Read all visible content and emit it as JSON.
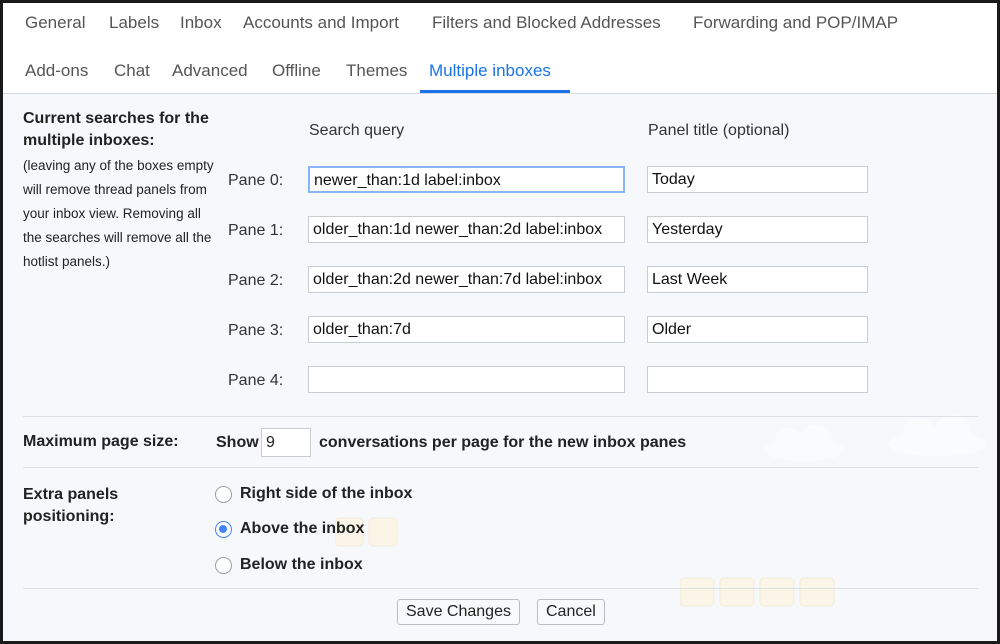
{
  "tabs": {
    "row1": [
      "General",
      "Labels",
      "Inbox",
      "Accounts and Import",
      "Filters and Blocked Addresses",
      "Forwarding and POP/IMAP"
    ],
    "row2": [
      "Add-ons",
      "Chat",
      "Advanced",
      "Offline",
      "Themes",
      "Multiple inboxes"
    ],
    "active": "Multiple inboxes"
  },
  "searches": {
    "heading": "Current searches for the multiple inboxes:",
    "note": "(leaving any of the boxes empty will remove thread panels from your inbox view. Removing all the searches will remove all the hotlist panels.)",
    "query_header": "Search query",
    "title_header": "Panel title (optional)",
    "panes": [
      {
        "label": "Pane 0:",
        "query": "newer_than:1d label:inbox",
        "title": "Today"
      },
      {
        "label": "Pane 1:",
        "query": "older_than:1d newer_than:2d label:inbox",
        "title": "Yesterday"
      },
      {
        "label": "Pane 2:",
        "query": "older_than:2d newer_than:7d label:inbox",
        "title": "Last Week"
      },
      {
        "label": "Pane 3:",
        "query": "older_than:7d",
        "title": "Older"
      },
      {
        "label": "Pane 4:",
        "query": "",
        "title": ""
      }
    ]
  },
  "page_size": {
    "label": "Maximum page size:",
    "prefix": "Show",
    "value": "9",
    "suffix": "conversations per page for the new inbox panes"
  },
  "positioning": {
    "label": "Extra panels positioning:",
    "options": [
      "Right side of the inbox",
      "Above the inbox",
      "Below the inbox"
    ],
    "selected": "Above the inbox"
  },
  "actions": {
    "save": "Save Changes",
    "cancel": "Cancel"
  },
  "colors": {
    "accent": "#1a73e8",
    "radio": "#4285f4"
  }
}
